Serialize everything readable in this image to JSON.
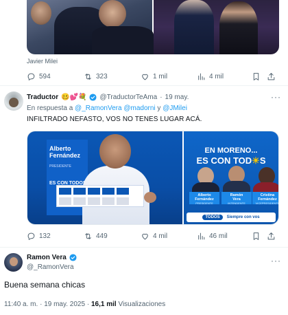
{
  "top_tweet": {
    "caption": "Javier Milei",
    "stats": {
      "replies": "594",
      "retweets": "323",
      "likes": "1 mil",
      "views": "4 mil"
    }
  },
  "reply_tweet": {
    "display_name": "Traductor",
    "name_emojis": "🥴💕💐",
    "handle": "@TraductorTeAma",
    "separator": "·",
    "date": "19 may.",
    "more": "···",
    "replying_prefix": "En respuesta a",
    "replying_1": "@_RamonVera",
    "replying_2": "@madorni",
    "replying_joiner": "y",
    "replying_3": "@JMilei",
    "text": "INFILTRADO NEFASTO, VOS NO TENES LUGAR ACÁ.",
    "stats": {
      "replies": "132",
      "retweets": "449",
      "likes": "4 mil",
      "views": "46 mil"
    },
    "image_right": {
      "line1": "EN MORENO...",
      "line2_prefix": "ES CON TOD",
      "line2_suffix": "S",
      "candidates": [
        {
          "first": "Alberto",
          "last": "Fernández",
          "role": "PRESIDENTE"
        },
        {
          "first": "Ramón",
          "last": "Vera",
          "role": "INTENDENTE"
        },
        {
          "first": "Cristina",
          "last": "Fernández",
          "role": "VICEPRESIDENTE"
        }
      ],
      "footer_brand": "TODOS",
      "footer_slogan": "Siempre con vos"
    },
    "image_left": {
      "banner_name": "Alberto Fernández",
      "banner_role": "PRESIDENTE",
      "banner_slogan": "ES CON TODOS"
    }
  },
  "main_tweet": {
    "display_name": "Ramon Vera",
    "handle": "@_RamonVera",
    "text": "Buena semana chicas",
    "time": "11:40 a. m.",
    "separator": "·",
    "date": "19 may. 2025",
    "separator2": "·",
    "views_count": "16,1 mil",
    "views_label": "Visualizaciones"
  },
  "colors": {
    "accent": "#1d9bf0",
    "muted": "#536471",
    "text": "#0f1419",
    "divider": "#eff3f4"
  }
}
